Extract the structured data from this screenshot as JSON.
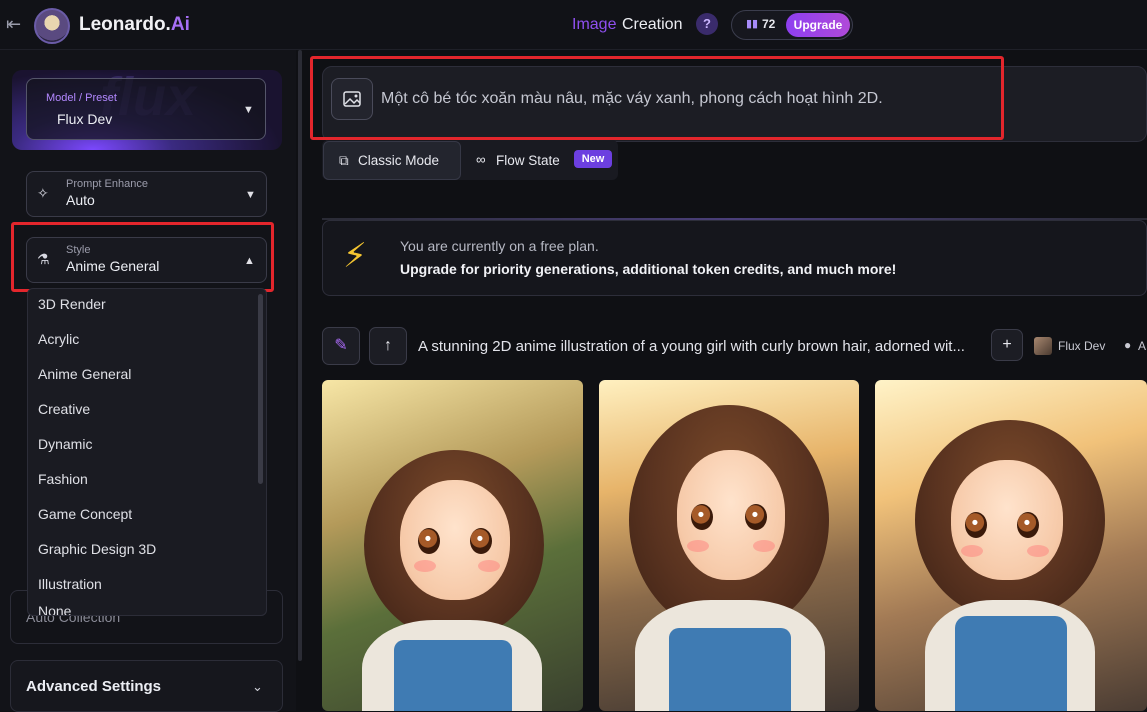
{
  "topbar": {
    "back_glyph": "⇤",
    "brand_main": "Leonardo.",
    "brand_ai": "Ai",
    "title_word1": "Image",
    "title_word2": "Creation",
    "help_glyph": "?",
    "tokens": "72",
    "upgrade_label": "Upgrade"
  },
  "sidebar": {
    "model_label": "Model / Preset",
    "model_value": "Flux Dev",
    "model_watermark": "flux",
    "prompt_enhance_label": "Prompt Enhance",
    "prompt_enhance_value": "Auto",
    "style_label": "Style",
    "style_value": "Anime General",
    "style_options": [
      "3D Render",
      "Acrylic",
      "Anime General",
      "Creative",
      "Dynamic",
      "Fashion",
      "Game Concept",
      "Graphic Design 3D",
      "Illustration",
      "None"
    ],
    "hidden_section_label": "Auto Collection",
    "advanced_label": "Advanced Settings"
  },
  "main": {
    "prompt_text": "Một cô bé tóc xoăn màu nâu, mặc váy xanh, phong cách hoạt hình 2D.",
    "mode_classic": "Classic Mode",
    "mode_flow": "Flow State",
    "new_badge": "New",
    "banner_line1": "You are currently on a free plan.",
    "banner_line2": "Upgrade for priority generations, additional token credits, and much more!",
    "generation_prompt": "A stunning 2D anime illustration of a young girl with curly brown hair, adorned wit...",
    "generation_model": "Flux Dev",
    "generation_extra": "A"
  },
  "colors": {
    "accent": "#8e3ff0",
    "highlight_red": "#e3262c",
    "bolt": "#f4c531"
  },
  "icons": [
    "back-icon",
    "help-icon",
    "token-icon",
    "caret-down-icon",
    "sparkle-icon",
    "flask-icon",
    "caret-up-icon",
    "image-icon",
    "classic-mode-icon",
    "infinity-icon",
    "lightning-icon",
    "brush-icon",
    "arrow-up-icon",
    "plus-icon",
    "droplet-icon",
    "chevron-down-icon"
  ]
}
